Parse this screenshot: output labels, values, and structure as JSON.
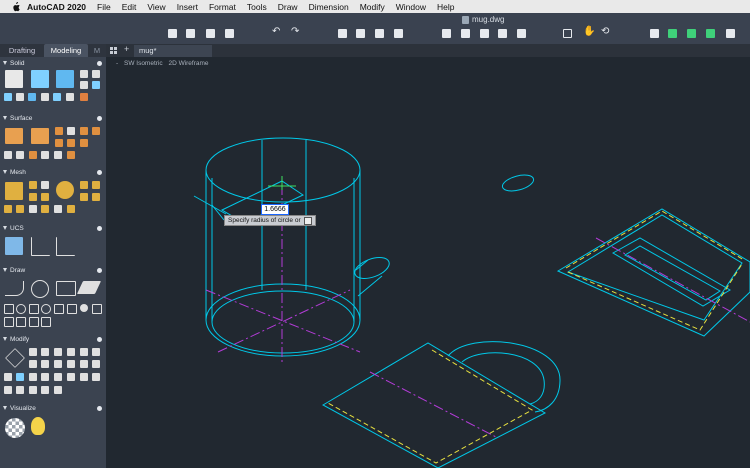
{
  "menubar": {
    "app_name": "AutoCAD 2020",
    "items": [
      "File",
      "Edit",
      "View",
      "Insert",
      "Format",
      "Tools",
      "Draw",
      "Dimension",
      "Modify",
      "Window",
      "Help"
    ]
  },
  "window": {
    "title": "mug.dwg"
  },
  "palette": {
    "tabs": [
      "Drafting",
      "Modeling",
      "M"
    ],
    "sections": [
      "Solid",
      "Surface",
      "Mesh",
      "UCS",
      "Draw",
      "Modify",
      "Visualize"
    ]
  },
  "doc_tab": {
    "label": "mug*"
  },
  "viewport": {
    "view": "SW Isometric",
    "style": "2D Wireframe",
    "minus": "-"
  },
  "dynamic_input": {
    "value": "1.6666",
    "prompt": "Specify radius of circle or"
  },
  "colors": {
    "cyan": "#00c8e8",
    "magenta": "#b23cd6",
    "yellow": "#e6e040",
    "green": "#40e060"
  }
}
